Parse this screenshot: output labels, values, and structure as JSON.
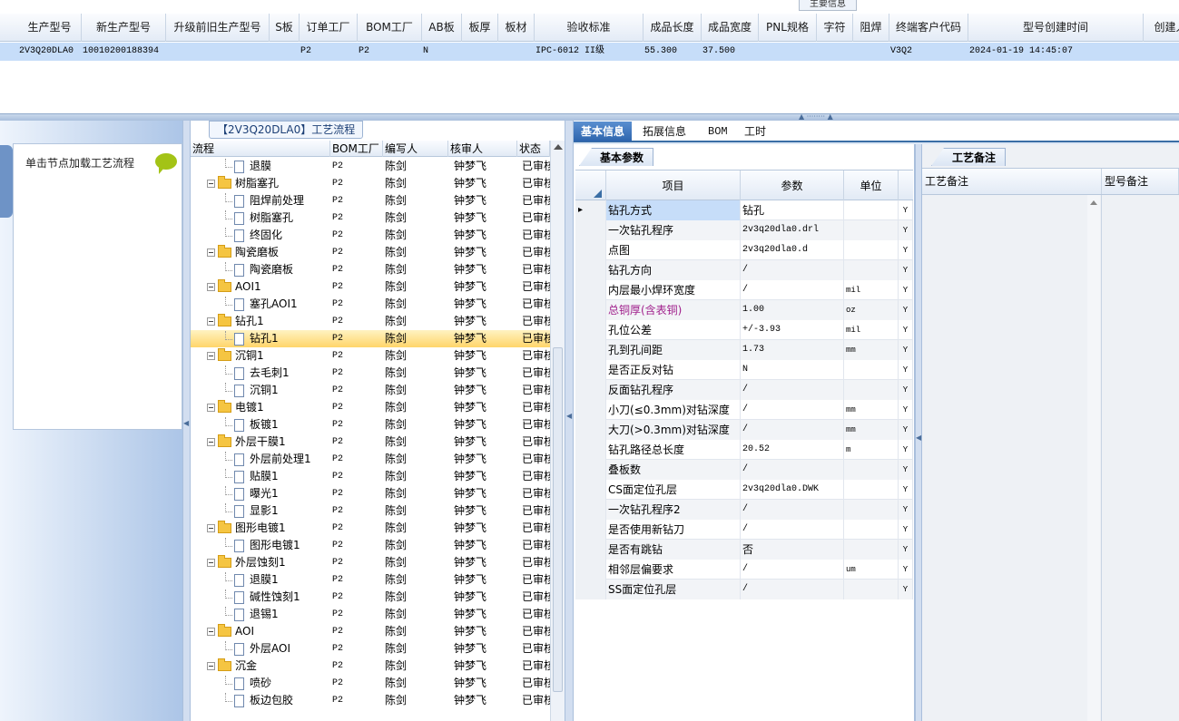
{
  "top_grid": {
    "tab_label": "主要信息",
    "columns": [
      "生产型号",
      "新生产型号",
      "升级前旧生产型号",
      "S板",
      "订单工厂",
      "BOM工厂",
      "AB板",
      "板厚",
      "板材",
      "验收标准",
      "成品长度",
      "成品宽度",
      "PNL规格",
      "字符",
      "阻焊",
      "终端客户代码",
      "型号创建时间",
      "创建人"
    ],
    "row": [
      "2V3Q20DLA0",
      "10010200188394",
      "",
      "",
      "P2",
      "P2",
      "N",
      "",
      "",
      "IPC-6012 II级",
      "55.300",
      "37.500",
      "",
      "",
      "",
      "V3Q2",
      "2024-01-19 14:45:07",
      ""
    ]
  },
  "left_panel": {
    "node_hint": "单击节点加载工艺流程"
  },
  "process_tree": {
    "title": "【2V3Q20DLA0】工艺流程",
    "columns": [
      "流程",
      "BOM工厂",
      "编写人",
      "核审人",
      "状态"
    ],
    "rows": [
      {
        "level": 2,
        "name": "退膜",
        "bom": "P2",
        "writer": "陈剑",
        "checker": "钟梦飞",
        "status": "已审核"
      },
      {
        "level": 1,
        "name": "树脂塞孔",
        "bom": "P2",
        "writer": "陈剑",
        "checker": "钟梦飞",
        "status": "已审核"
      },
      {
        "level": 2,
        "name": "阻焊前处理",
        "bom": "P2",
        "writer": "陈剑",
        "checker": "钟梦飞",
        "status": "已审核"
      },
      {
        "level": 2,
        "name": "树脂塞孔",
        "bom": "P2",
        "writer": "陈剑",
        "checker": "钟梦飞",
        "status": "已审核"
      },
      {
        "level": 2,
        "name": "终固化",
        "bom": "P2",
        "writer": "陈剑",
        "checker": "钟梦飞",
        "status": "已审核"
      },
      {
        "level": 1,
        "name": "陶瓷磨板",
        "bom": "P2",
        "writer": "陈剑",
        "checker": "钟梦飞",
        "status": "已审核"
      },
      {
        "level": 2,
        "name": "陶瓷磨板",
        "bom": "P2",
        "writer": "陈剑",
        "checker": "钟梦飞",
        "status": "已审核"
      },
      {
        "level": 1,
        "name": "AOI1",
        "bom": "P2",
        "writer": "陈剑",
        "checker": "钟梦飞",
        "status": "已审核"
      },
      {
        "level": 2,
        "name": "塞孔AOI1",
        "bom": "P2",
        "writer": "陈剑",
        "checker": "钟梦飞",
        "status": "已审核"
      },
      {
        "level": 1,
        "name": "钻孔1",
        "bom": "P2",
        "writer": "陈剑",
        "checker": "钟梦飞",
        "status": "已审核"
      },
      {
        "level": 2,
        "name": "钻孔1",
        "bom": "P2",
        "writer": "陈剑",
        "checker": "钟梦飞",
        "status": "已审核",
        "selected": true
      },
      {
        "level": 1,
        "name": "沉铜1",
        "bom": "P2",
        "writer": "陈剑",
        "checker": "钟梦飞",
        "status": "已审核"
      },
      {
        "level": 2,
        "name": "去毛刺1",
        "bom": "P2",
        "writer": "陈剑",
        "checker": "钟梦飞",
        "status": "已审核"
      },
      {
        "level": 2,
        "name": "沉铜1",
        "bom": "P2",
        "writer": "陈剑",
        "checker": "钟梦飞",
        "status": "已审核"
      },
      {
        "level": 1,
        "name": "电镀1",
        "bom": "P2",
        "writer": "陈剑",
        "checker": "钟梦飞",
        "status": "已审核"
      },
      {
        "level": 2,
        "name": "板镀1",
        "bom": "P2",
        "writer": "陈剑",
        "checker": "钟梦飞",
        "status": "已审核"
      },
      {
        "level": 1,
        "name": "外层干膜1",
        "bom": "P2",
        "writer": "陈剑",
        "checker": "钟梦飞",
        "status": "已审核"
      },
      {
        "level": 2,
        "name": "外层前处理1",
        "bom": "P2",
        "writer": "陈剑",
        "checker": "钟梦飞",
        "status": "已审核"
      },
      {
        "level": 2,
        "name": "贴膜1",
        "bom": "P2",
        "writer": "陈剑",
        "checker": "钟梦飞",
        "status": "已审核"
      },
      {
        "level": 2,
        "name": "曝光1",
        "bom": "P2",
        "writer": "陈剑",
        "checker": "钟梦飞",
        "status": "已审核"
      },
      {
        "level": 2,
        "name": "显影1",
        "bom": "P2",
        "writer": "陈剑",
        "checker": "钟梦飞",
        "status": "已审核"
      },
      {
        "level": 1,
        "name": "图形电镀1",
        "bom": "P2",
        "writer": "陈剑",
        "checker": "钟梦飞",
        "status": "已审核"
      },
      {
        "level": 2,
        "name": "图形电镀1",
        "bom": "P2",
        "writer": "陈剑",
        "checker": "钟梦飞",
        "status": "已审核"
      },
      {
        "level": 1,
        "name": "外层蚀刻1",
        "bom": "P2",
        "writer": "陈剑",
        "checker": "钟梦飞",
        "status": "已审核"
      },
      {
        "level": 2,
        "name": "退膜1",
        "bom": "P2",
        "writer": "陈剑",
        "checker": "钟梦飞",
        "status": "已审核"
      },
      {
        "level": 2,
        "name": "碱性蚀刻1",
        "bom": "P2",
        "writer": "陈剑",
        "checker": "钟梦飞",
        "status": "已审核"
      },
      {
        "level": 2,
        "name": "退锡1",
        "bom": "P2",
        "writer": "陈剑",
        "checker": "钟梦飞",
        "status": "已审核"
      },
      {
        "level": 1,
        "name": "AOI",
        "bom": "P2",
        "writer": "陈剑",
        "checker": "钟梦飞",
        "status": "已审核"
      },
      {
        "level": 2,
        "name": "外层AOI",
        "bom": "P2",
        "writer": "陈剑",
        "checker": "钟梦飞",
        "status": "已审核"
      },
      {
        "level": 1,
        "name": "沉金",
        "bom": "P2",
        "writer": "陈剑",
        "checker": "钟梦飞",
        "status": "已审核"
      },
      {
        "level": 2,
        "name": "喷砂",
        "bom": "P2",
        "writer": "陈剑",
        "checker": "钟梦飞",
        "status": "已审核"
      },
      {
        "level": 2,
        "name": "板边包胶",
        "bom": "P2",
        "writer": "陈剑",
        "checker": "钟梦飞",
        "status": "已审核"
      }
    ]
  },
  "right_tabs": [
    "基本信息",
    "拓展信息",
    "BOM",
    "工时"
  ],
  "basic_params": {
    "group_label": "基本参数",
    "columns": [
      "项目",
      "参数",
      "单位"
    ],
    "rows": [
      {
        "item": "钻孔方式",
        "value": "钻孔",
        "unit": "",
        "flag": "Y",
        "current": true
      },
      {
        "item": "一次钻孔程序",
        "value": "2v3q20dla0.drl",
        "unit": "",
        "flag": "Y"
      },
      {
        "item": "点图",
        "value": "2v3q20dla0.d",
        "unit": "",
        "flag": "Y"
      },
      {
        "item": "钻孔方向",
        "value": "/",
        "unit": "",
        "flag": "Y"
      },
      {
        "item": "内层最小焊环宽度",
        "value": "/",
        "unit": "mil",
        "flag": "Y"
      },
      {
        "item": "总铜厚(含表铜)",
        "value": "1.00",
        "unit": "oz",
        "flag": "Y",
        "highlight": true
      },
      {
        "item": "孔位公差",
        "value": "+/-3.93",
        "unit": "mil",
        "flag": "Y"
      },
      {
        "item": "孔到孔间距",
        "value": "1.73",
        "unit": "mm",
        "flag": "Y"
      },
      {
        "item": "是否正反对钻",
        "value": "N",
        "unit": "",
        "flag": "Y"
      },
      {
        "item": "反面钻孔程序",
        "value": "/",
        "unit": "",
        "flag": "Y"
      },
      {
        "item": "小刀(≤0.3mm)对钻深度",
        "value": "/",
        "unit": "mm",
        "flag": "Y"
      },
      {
        "item": "大刀(>0.3mm)对钻深度",
        "value": "/",
        "unit": "mm",
        "flag": "Y"
      },
      {
        "item": "钻孔路径总长度",
        "value": "20.52",
        "unit": "m",
        "flag": "Y"
      },
      {
        "item": "叠板数",
        "value": "/",
        "unit": "",
        "flag": "Y"
      },
      {
        "item": "CS面定位孔层",
        "value": "2v3q20dla0.DWK",
        "unit": "",
        "flag": "Y"
      },
      {
        "item": "一次钻孔程序2",
        "value": "/",
        "unit": "",
        "flag": "Y"
      },
      {
        "item": "是否使用新钻刀",
        "value": "/",
        "unit": "",
        "flag": "Y"
      },
      {
        "item": "是否有跳钻",
        "value": "否",
        "unit": "",
        "flag": "Y"
      },
      {
        "item": "相邻层偏要求",
        "value": "/",
        "unit": "um",
        "flag": "Y"
      },
      {
        "item": "SS面定位孔层",
        "value": "/",
        "unit": "",
        "flag": "Y"
      }
    ]
  },
  "notes": {
    "group_label": "工艺备注",
    "columns": [
      "工艺备注",
      "型号备注"
    ]
  },
  "colors": {
    "accent": "#3a6ea5",
    "selected_row": "#c6ddf9",
    "highlight_text": "#a0208c"
  }
}
